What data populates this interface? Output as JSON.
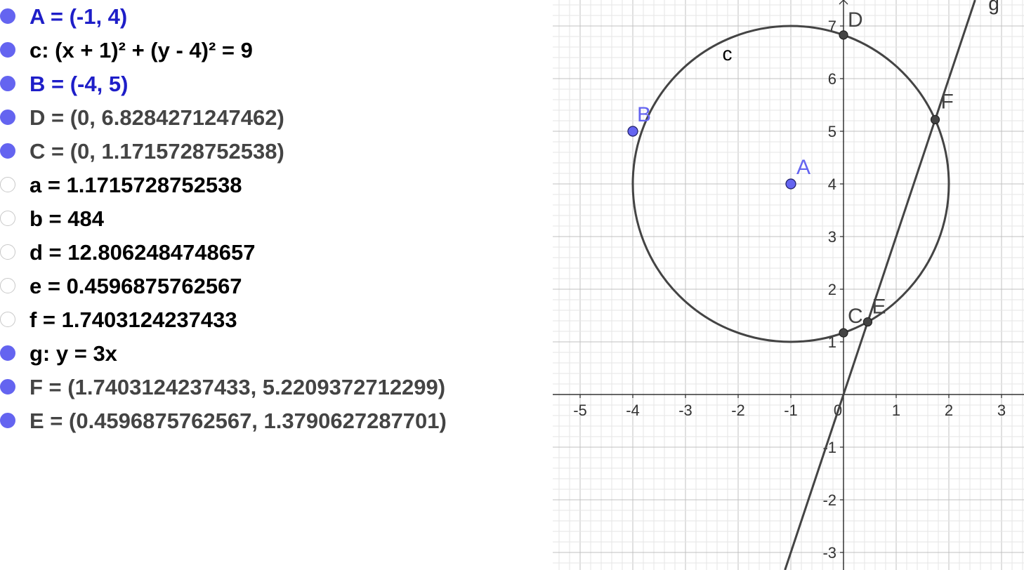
{
  "algebra_view": {
    "items": [
      {
        "text": "A = (-1, 4)",
        "visible": true,
        "color": "#1e1ec8"
      },
      {
        "text": "c: (x + 1)² + (y - 4)² = 9",
        "visible": true,
        "color": "#000000"
      },
      {
        "text": "B = (-4, 5)",
        "visible": true,
        "color": "#1e1ec8"
      },
      {
        "text": "D = (0, 6.8284271247462)",
        "visible": true,
        "color": "#444444"
      },
      {
        "text": "C = (0, 1.1715728752538)",
        "visible": true,
        "color": "#444444"
      },
      {
        "text": "a = 1.1715728752538",
        "visible": false,
        "color": "#000000"
      },
      {
        "text": "b = 484",
        "visible": false,
        "color": "#000000"
      },
      {
        "text": "d = 12.8062484748657",
        "visible": false,
        "color": "#000000"
      },
      {
        "text": "e = 0.4596875762567",
        "visible": false,
        "color": "#000000"
      },
      {
        "text": "f = 1.7403124237433",
        "visible": false,
        "color": "#000000"
      },
      {
        "text": "g: y = 3x",
        "visible": true,
        "color": "#000000"
      },
      {
        "text": "F = (1.7403124237433, 5.2209372712299)",
        "visible": true,
        "color": "#444444"
      },
      {
        "text": "E = (0.4596875762567, 1.3790627287701)",
        "visible": true,
        "color": "#444444"
      }
    ]
  },
  "graphics_view": {
    "x_ticks": [
      "-5",
      "-4",
      "-3",
      "-2",
      "-1",
      "0",
      "1",
      "2",
      "3"
    ],
    "y_ticks": [
      "1",
      "2",
      "3",
      "4",
      "5",
      "6",
      "7"
    ],
    "y_ticks_neg": [
      "-1",
      "-2",
      "-3"
    ],
    "circle": {
      "name": "c",
      "center": [
        -1,
        4
      ],
      "radius": 3,
      "label": "c",
      "color": "#444444"
    },
    "line": {
      "name": "g",
      "slope": 3,
      "intercept": 0,
      "label": "g",
      "color": "#444444"
    },
    "points": [
      {
        "name": "A",
        "x": -1,
        "y": 4,
        "label": "A",
        "color": "#6464f0",
        "label_color": "#6464f0",
        "free": true
      },
      {
        "name": "B",
        "x": -4,
        "y": 5,
        "label": "B",
        "color": "#6464f0",
        "label_color": "#6464f0",
        "free": true
      },
      {
        "name": "D",
        "x": 0,
        "y": 6.8284271247462,
        "label": "D",
        "color": "#444444",
        "label_color": "#444444",
        "free": false
      },
      {
        "name": "C",
        "x": 0,
        "y": 1.1715728752538,
        "label": "C",
        "color": "#444444",
        "label_color": "#444444",
        "free": false
      },
      {
        "name": "F",
        "x": 1.7403124237433,
        "y": 5.2209372712299,
        "label": "F",
        "color": "#444444",
        "label_color": "#444444",
        "free": false
      },
      {
        "name": "E",
        "x": 0.4596875762567,
        "y": 1.3790627287701,
        "label": "E",
        "color": "#444444",
        "label_color": "#444444",
        "free": false
      }
    ],
    "grid": true,
    "axes": true
  }
}
